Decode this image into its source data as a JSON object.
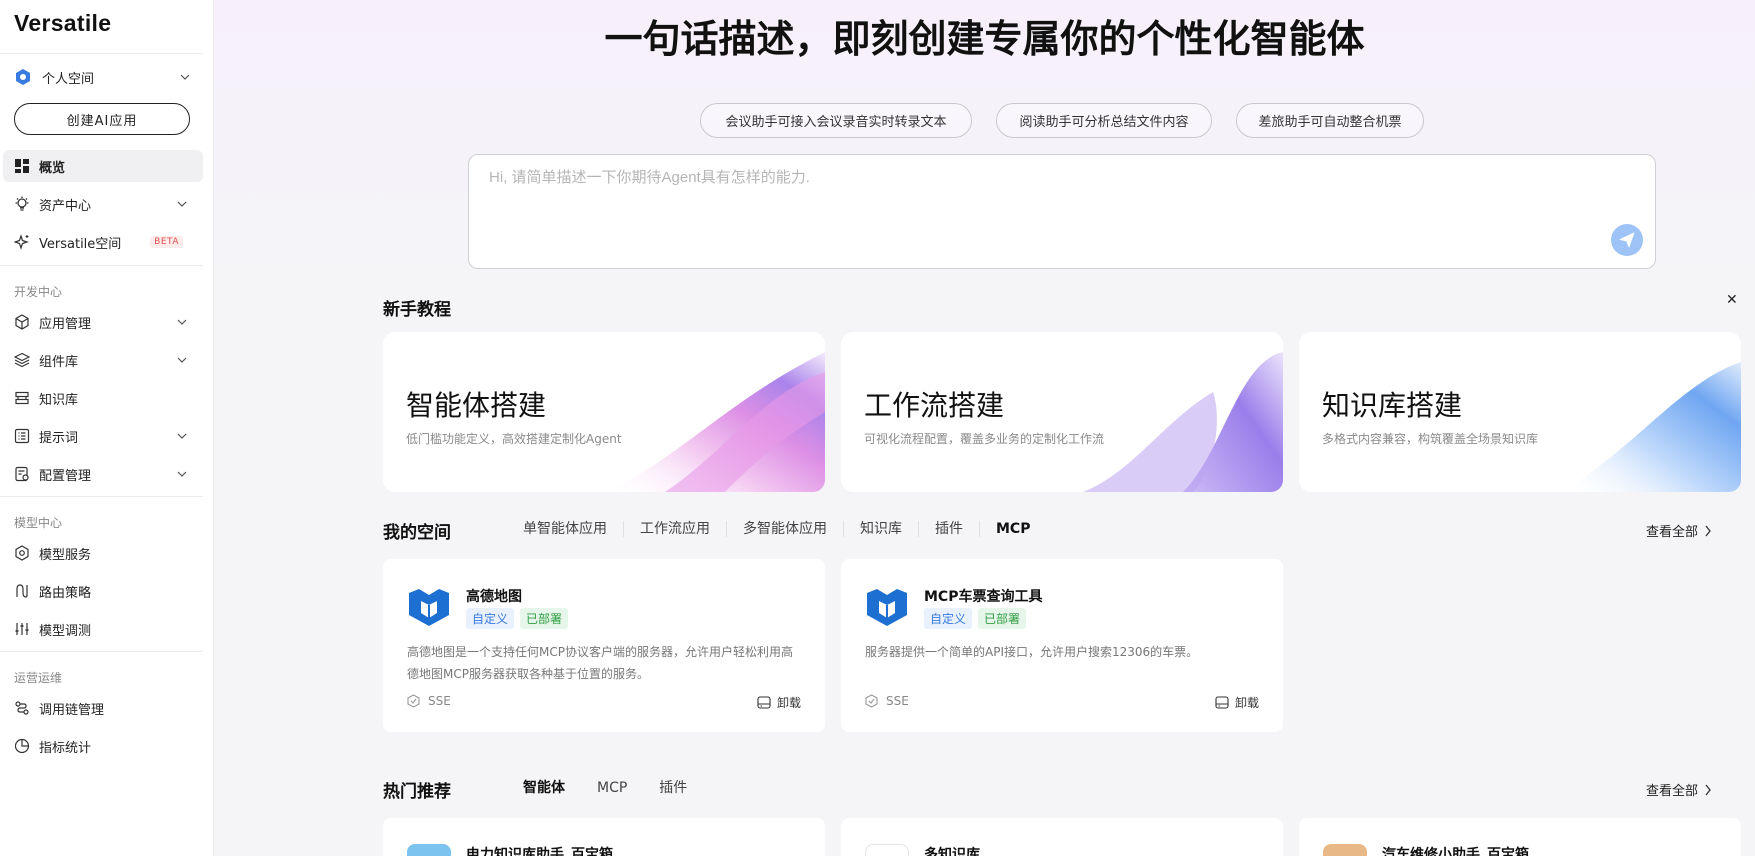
{
  "app": {
    "brand": "Versatile"
  },
  "sidebar": {
    "space_label": "个人空间",
    "create_button": "创建AI应用",
    "items_top": [
      {
        "label": "概览",
        "icon": "dashboard-icon",
        "active": true
      },
      {
        "label": "资产中心",
        "icon": "lightbulb-icon",
        "expandable": true
      },
      {
        "label": "Versatile空间",
        "icon": "sparkle-icon",
        "badge": "BETA"
      }
    ],
    "dev_section": "开发中心",
    "dev_items": [
      {
        "label": "应用管理",
        "icon": "cube-icon",
        "expandable": true
      },
      {
        "label": "组件库",
        "icon": "layers-icon",
        "expandable": true
      },
      {
        "label": "知识库",
        "icon": "database-icon"
      },
      {
        "label": "提示词",
        "icon": "list-icon",
        "expandable": true
      },
      {
        "label": "配置管理",
        "icon": "config-icon",
        "expandable": true
      }
    ],
    "model_section": "模型中心",
    "model_items": [
      {
        "label": "模型服务",
        "icon": "hexagon-icon"
      },
      {
        "label": "路由策略",
        "icon": "route-icon"
      },
      {
        "label": "模型调测",
        "icon": "sliders-icon"
      }
    ],
    "ops_section": "运营运维",
    "ops_items": [
      {
        "label": "调用链管理",
        "icon": "trace-icon"
      },
      {
        "label": "指标统计",
        "icon": "chart-icon"
      }
    ]
  },
  "hero": {
    "title": "一句话描述，即刻创建专属你的个性化智能体",
    "chips": [
      "会议助手可接入会议录音实时转录文本",
      "阅读助手可分析总结文件内容",
      "差旅助手可自动整合机票"
    ],
    "placeholder": "Hi, 请简单描述一下你期待Agent具有怎样的能力."
  },
  "tutorial": {
    "title": "新手教程",
    "cards": [
      {
        "title": "智能体搭建",
        "desc": "低门槛功能定义，高效搭建定制化Agent"
      },
      {
        "title": "工作流搭建",
        "desc": "可视化流程配置，覆盖多业务的定制化工作流"
      },
      {
        "title": "知识库搭建",
        "desc": "多格式内容兼容，构筑覆盖全场景知识库"
      }
    ]
  },
  "my_space": {
    "title": "我的空间",
    "tabs": [
      "单智能体应用",
      "工作流应用",
      "多智能体应用",
      "知识库",
      "插件",
      "MCP"
    ],
    "active_tab": "MCP",
    "view_all": "查看全部",
    "cards": [
      {
        "name": "高德地图",
        "tag_custom": "自定义",
        "tag_status": "已部署",
        "desc": "高德地图是一个支持任何MCP协议客户端的服务器，允许用户轻松利用高德地图MCP服务器获取各种基于位置的服务。",
        "protocol": "SSE",
        "action": "卸载"
      },
      {
        "name": "MCP车票查询工具",
        "tag_custom": "自定义",
        "tag_status": "已部署",
        "desc": "服务器提供一个简单的API接口，允许用户搜索12306的车票。",
        "protocol": "SSE",
        "action": "卸载"
      }
    ]
  },
  "hot": {
    "title": "热门推荐",
    "tabs": [
      "智能体",
      "MCP",
      "插件"
    ],
    "active_tab": "智能体",
    "view_all": "查看全部",
    "cards": [
      {
        "name": "电力知识库助手_百宝箱"
      },
      {
        "name": "多知识库"
      },
      {
        "name": "汽车维修小助手_百宝箱"
      }
    ]
  },
  "colors": {
    "accent_blue": "#3a7be0",
    "send_button": "#9ec4f7",
    "deployed_green": "#2f9e44",
    "beta_red": "#e04f4f"
  }
}
